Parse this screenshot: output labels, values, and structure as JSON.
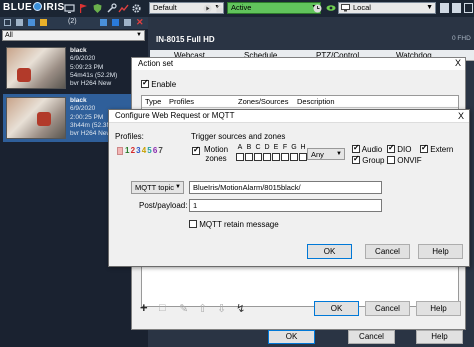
{
  "app": {
    "name_left": "BLUE",
    "name_right": "IRIS"
  },
  "topbar": {
    "profile_select": "Default",
    "status": "Active",
    "server_select": "Local",
    "tab_count": "(2)"
  },
  "left_panel": {
    "filter": "All",
    "clips": [
      {
        "camera": "black",
        "date": "6/9/2020",
        "time": "5:09:23 PM",
        "size": "54m41s (52.2M)",
        "codec": "bvr H264 New"
      },
      {
        "camera": "black",
        "date": "6/9/2020",
        "time": "2:00:25 PM",
        "size": "3h44m (52.3M)",
        "codec": "bvr H264 New"
      }
    ]
  },
  "main": {
    "camera_title": "IN-8015 Full HD",
    "fhd_label": "0 FHD",
    "tabs": [
      "Webcast",
      "Schedule",
      "PTZ/Control",
      "Watchdog"
    ]
  },
  "action_set": {
    "title": "Action set",
    "close": "X",
    "enable_label": "Enable",
    "enabled": true,
    "columns": [
      "Type",
      "Profiles",
      "Zones/Sources",
      "Description"
    ],
    "ok": "OK",
    "cancel": "Cancel",
    "help": "Help"
  },
  "config": {
    "title": "Configure Web Request or MQTT",
    "close": "X",
    "profiles_label": "Profiles:",
    "profiles": [
      "1",
      "2",
      "3",
      "4",
      "5",
      "6",
      "7"
    ],
    "profile_colors": [
      "#2a7a2a",
      "#d42a2a",
      "#2a56c8",
      "#c8a000",
      "#20a0a0",
      "#8a2ab0",
      "#4a4a4a"
    ],
    "trigger_label": "Trigger sources and zones",
    "motion_label": "Motion",
    "zones_label": "zones",
    "zones": [
      "A",
      "B",
      "C",
      "D",
      "E",
      "F",
      "G",
      "H"
    ],
    "any_select": "Any",
    "sources": [
      {
        "label": "Audio",
        "checked": true
      },
      {
        "label": "DIO",
        "checked": true
      },
      {
        "label": "Extern",
        "checked": true
      },
      {
        "label": "Group",
        "checked": true
      },
      {
        "label": "ONVIF",
        "checked": false
      }
    ],
    "mode_select": "MQTT topic",
    "topic": "BlueIris/MotionAlarm/8015black/",
    "payload_label": "Post/payload:",
    "payload": "1",
    "retain_label": "MQTT retain message",
    "ok": "OK",
    "cancel": "Cancel",
    "help": "Help"
  },
  "outer_buttons": {
    "ok": "OK",
    "cancel": "Cancel",
    "help": "Help"
  }
}
